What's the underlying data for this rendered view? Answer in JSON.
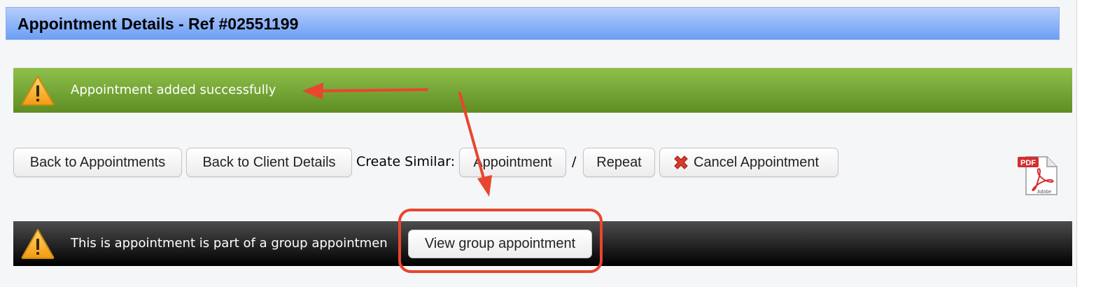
{
  "header": {
    "title": "Appointment Details - Ref #02551199"
  },
  "success_bar": {
    "icon": "warning-icon",
    "message": "Appointment added successfully",
    "color": "#76a636"
  },
  "actions": {
    "back_to_appointments": "Back to Appointments",
    "back_to_client_details": "Back to Client Details",
    "create_similar_label": "Create Similar:",
    "appointment": "Appointment",
    "separator": "/",
    "repeat": "Repeat",
    "cancel_appointment": "Cancel Appointment",
    "cancel_icon": "red-x-icon",
    "pdf_icon": "pdf-icon",
    "pdf_label": "PDF",
    "pdf_brand": "Adobe"
  },
  "group_bar": {
    "icon": "warning-icon",
    "message": "This is appointment is part of a group appointmen",
    "button": "View group appointment",
    "color": "#222222"
  },
  "annotation_color": "#e8462f"
}
